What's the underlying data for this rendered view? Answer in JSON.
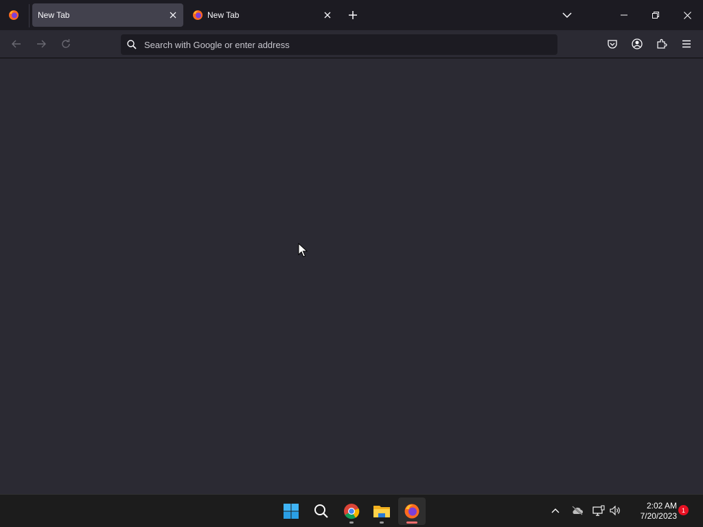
{
  "browser": {
    "tabs": [
      {
        "label": "New Tab",
        "active": true
      },
      {
        "label": "New Tab",
        "active": false
      }
    ],
    "new_tab_icon": "plus-icon",
    "list_tabs_icon": "chevron-down-icon",
    "window_controls": [
      "minimize-icon",
      "restore-icon",
      "close-icon"
    ]
  },
  "toolbar": {
    "nav_icons": [
      "back-arrow-icon",
      "forward-arrow-icon",
      "reload-icon"
    ],
    "url_placeholder": "Search with Google or enter address",
    "right_icons": [
      "pocket-icon",
      "account-icon",
      "extensions-icon",
      "menu-icon"
    ]
  },
  "taskbar": {
    "apps": [
      "windows-start-icon",
      "search-icon",
      "chrome-icon",
      "file-explorer-icon",
      "firefox-icon"
    ],
    "tray_icons": [
      "chevron-up-icon",
      "onedrive-offline-icon",
      "network-icon",
      "volume-icon"
    ],
    "time": "2:02 AM",
    "date": "7/20/2023",
    "notification_count": "1"
  },
  "colors": {
    "tabstrip_bg": "#1c1b22",
    "toolbar_bg": "#2b2a33",
    "active_tab_bg": "#42414d",
    "urlbar_bg": "#1c1b22",
    "taskbar_bg": "#1c1c1c",
    "badge": "#e81123"
  }
}
